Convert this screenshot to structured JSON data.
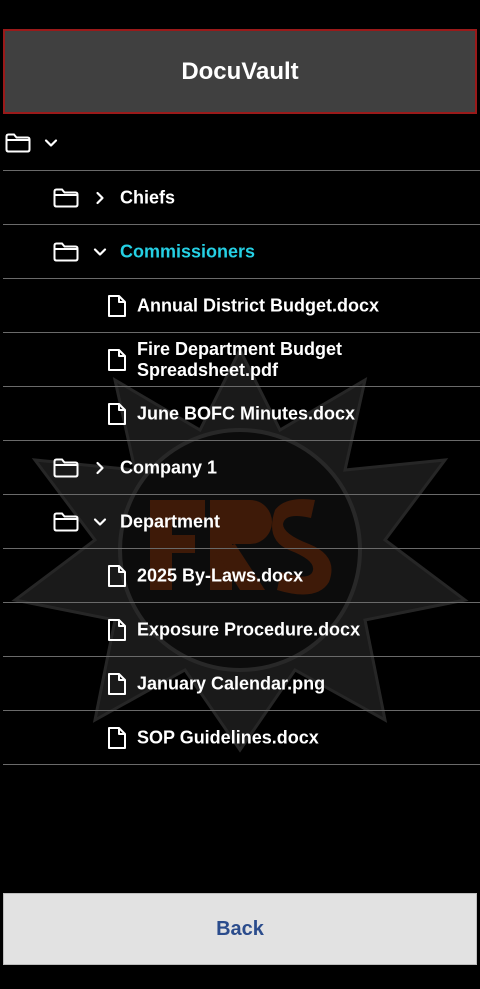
{
  "app": {
    "title": "DocuVault"
  },
  "tree": {
    "chiefs": "Chiefs",
    "commissioners": "Commissioners",
    "company1": "Company 1",
    "department": "Department",
    "files": {
      "annual_budget": "Annual District Budget.docx",
      "fire_budget_line1": "Fire Department Budget",
      "fire_budget_line2": "Spreadsheet.pdf",
      "june_minutes": "June BOFC Minutes.docx",
      "bylaws": "2025 By-Laws.docx",
      "exposure": "Exposure Procedure.docx",
      "calendar": "January Calendar.png",
      "sop": "SOP Guidelines.docx"
    }
  },
  "footer": {
    "back_label": "Back"
  },
  "colors": {
    "header_border": "#9a1a1a",
    "active_folder": "#25d0e4",
    "back_text": "#2b4c8c"
  },
  "watermark": {
    "text": "FRS"
  }
}
